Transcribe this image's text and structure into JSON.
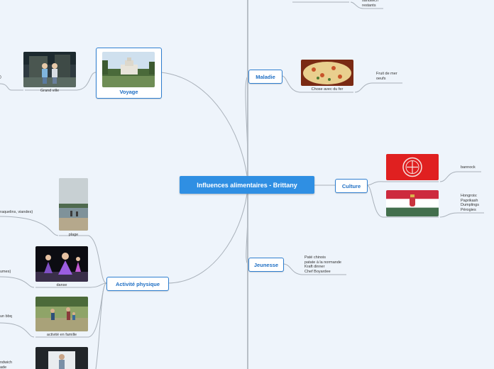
{
  "central": {
    "title": "Influences alimentaires - Brittany"
  },
  "branches": {
    "voyage": {
      "label": "Voyage",
      "images": [
        {
          "caption": "Grand ville"
        }
      ],
      "cut_text": ")"
    },
    "activite": {
      "label": "Activité physique",
      "images": [
        {
          "caption": "plage",
          "cut_text": "raquelins, viandes)"
        },
        {
          "caption": "danse",
          "cut_text": "umes)"
        },
        {
          "caption": "activité en famille",
          "cut_text": "un bbq"
        },
        {
          "caption": "",
          "cut_lines": [
            "ndwich",
            "ade"
          ]
        }
      ]
    },
    "maladie": {
      "label": "Maladie",
      "image_caption": "Chose avec du fer",
      "note_lines": [
        "Fruit de mer",
        "oeufs"
      ]
    },
    "culture": {
      "label": "Culture",
      "notes": [
        [
          "bannock"
        ],
        [
          "Hongrois:",
          "Paprikash",
          "Dumplings",
          "Pérogies"
        ]
      ]
    },
    "jeunesse": {
      "label": "Jeunesse",
      "note_lines": [
        "Paté chinois",
        "patate à la normande",
        "Kraft dinner",
        "Chef Boyardee"
      ]
    },
    "top_cut": {
      "note_lines": [
        "sandwich",
        "restants"
      ]
    }
  },
  "colors": {
    "background": "#eef4fb",
    "accent": "#2f8fe3",
    "topic_border": "#2f7fd0",
    "connector": "#a9b1ba"
  }
}
